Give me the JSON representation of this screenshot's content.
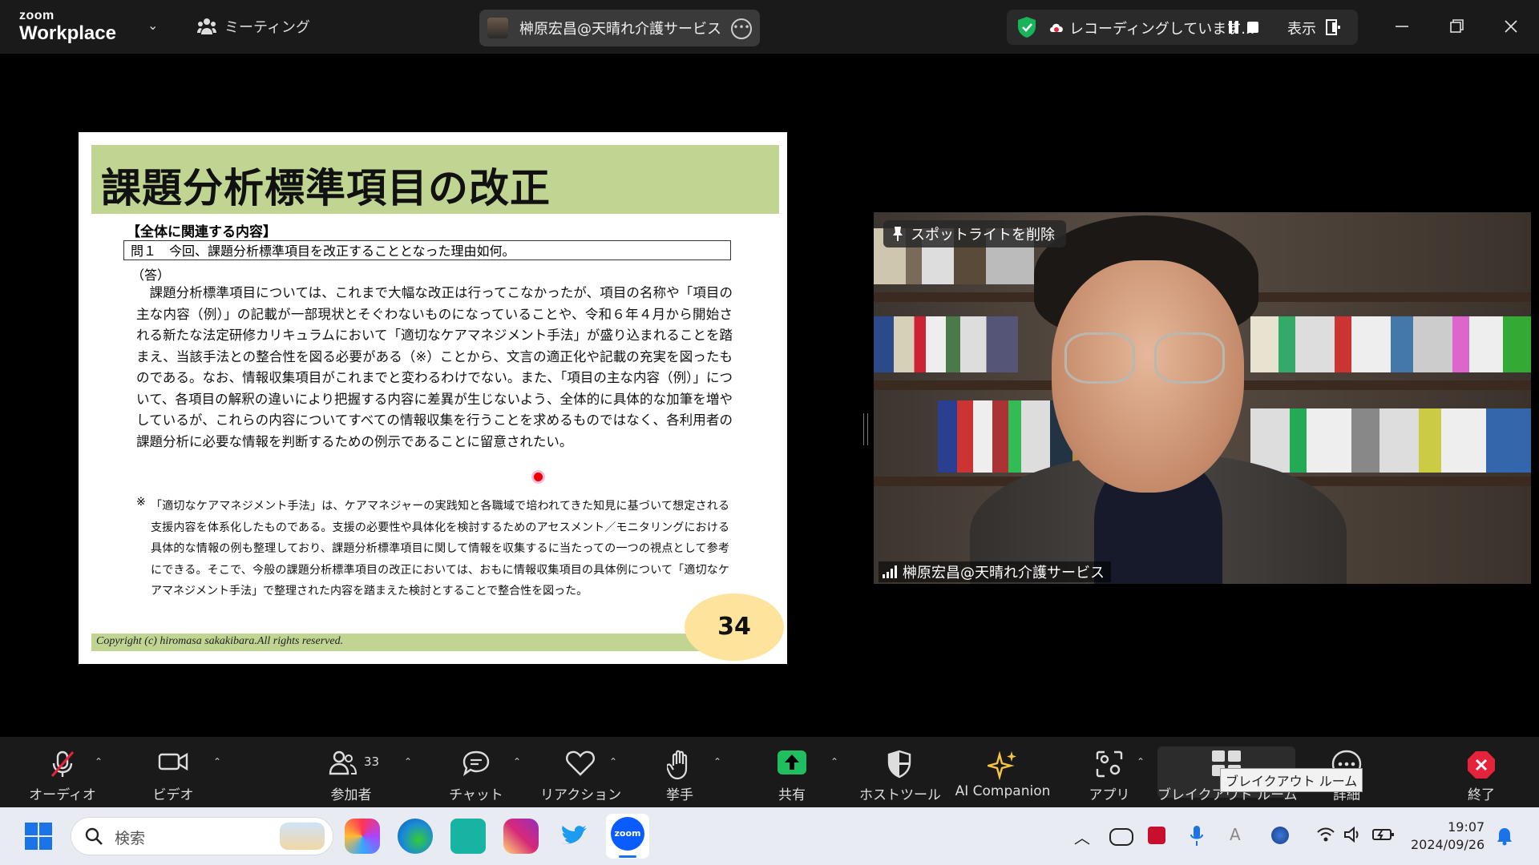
{
  "top": {
    "logo_line1": "zoom",
    "logo_line2": "Workplace",
    "meeting_menu": "ミーティング",
    "meeting_title": "榊原宏昌@天晴れ介護サービス",
    "recording_text": "レコーディングしています...",
    "view_label": "表示"
  },
  "slide": {
    "title": "課題分析標準項目の改正",
    "section_head": "【全体に関連する内容】",
    "question": "問１　今回、課題分析標準項目を改正することとなった理由如何。",
    "answer_label": "（答）",
    "body": "課題分析標準項目については、これまで大幅な改正は行ってこなかったが、項目の名称や「項目の主な内容（例）」の記載が一部現状とそぐわないものになっていることや、令和６年４月から開始される新たな法定研修カリキュラムにおいて「適切なケアマネジメント手法」が盛り込まれることを踏まえ、当該手法との整合性を図る必要がある（※）ことから、文言の適正化や記載の充実を図ったものである。なお、情報収集項目がこれまでと変わるわけでない。また、「項目の主な内容（例）」について、各項目の解釈の違いにより把握する内容に差異が生じないよう、全体的に具体的な加筆を増やしているが、これらの内容についてすべての情報収集を行うことを求めるものではなく、各利用者の課題分析に必要な情報を判断するための例示であることに留意されたい。",
    "note_mark": "※",
    "note": "「適切なケアマネジメント手法」は、ケアマネジャーの実践知と各職域で培われてきた知見に基づいて想定される支援内容を体系化したものである。支援の必要性や具体化を検討するためのアセスメント／モニタリングにおける具体的な情報の例も整理しており、課題分析標準項目に関して情報を収集するに当たっての一つの視点として参考にできる。そこで、今般の課題分析標準項目の改正においては、おもに情報収集項目の具体例について「適切なケアマネジメント手法」で整理された内容を踏まえた検討とすることで整合性を図った。",
    "copyright": "Copyright (c) hiromasa sakakibara.All rights reserved.",
    "page_number": "34"
  },
  "video": {
    "spotlight_button": "スポットライトを削除",
    "participant_name": "榊原宏昌@天晴れ介護サービス"
  },
  "toolbar": {
    "audio": "オーディオ",
    "video": "ビデオ",
    "participants": "参加者",
    "participants_count": "33",
    "chat": "チャット",
    "reactions": "リアクション",
    "raise_hand": "挙手",
    "share": "共有",
    "host_tools": "ホストツール",
    "ai_companion": "AI Companion",
    "apps": "アプリ",
    "breakout": "ブレイクアウト ルーム",
    "more": "詳細",
    "end": "終了",
    "tooltip": "ブレイクアウト ルーム"
  },
  "taskbar": {
    "search_placeholder": "検索",
    "time": "19:07",
    "date": "2024/09/26"
  },
  "colors": {
    "slide_green": "#bfd591",
    "page_badge": "#fde39c",
    "share_green": "#1fbf5f",
    "end_red": "#e5243b",
    "shield_green": "#19b35a"
  }
}
